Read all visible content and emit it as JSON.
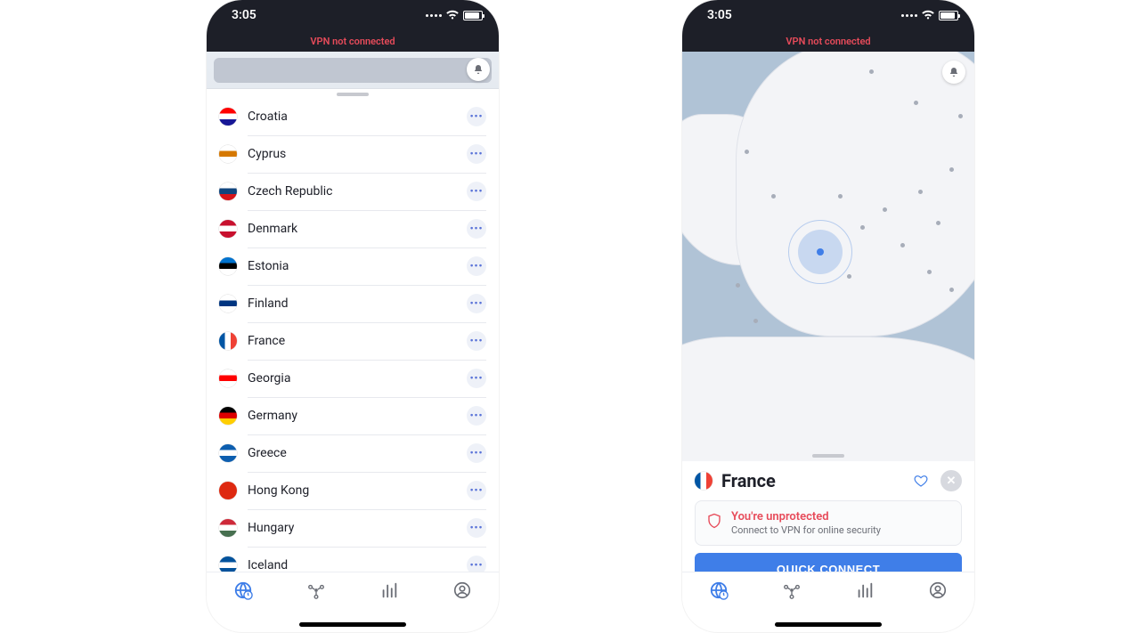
{
  "status": {
    "time": "3:05"
  },
  "banner": "VPN not connected",
  "countries": [
    {
      "name": "Croatia",
      "flag_top": "#ff0000",
      "flag_mid": "#ffffff",
      "flag_bot": "#171796"
    },
    {
      "name": "Cyprus",
      "flag_top": "#ffffff",
      "flag_mid": "#d57800",
      "flag_bot": "#ffffff"
    },
    {
      "name": "Czech Republic",
      "flag_top": "#ffffff",
      "flag_mid": "#11457e",
      "flag_bot": "#d7141a"
    },
    {
      "name": "Denmark",
      "flag_top": "#c8102e",
      "flag_mid": "#ffffff",
      "flag_bot": "#c8102e"
    },
    {
      "name": "Estonia",
      "flag_top": "#0072ce",
      "flag_mid": "#000000",
      "flag_bot": "#ffffff"
    },
    {
      "name": "Finland",
      "flag_top": "#ffffff",
      "flag_mid": "#003580",
      "flag_bot": "#ffffff"
    },
    {
      "name": "France",
      "flag_top": "#0055a4",
      "flag_mid": "#ffffff",
      "flag_bot": "#ef4135"
    },
    {
      "name": "Georgia",
      "flag_top": "#ffffff",
      "flag_mid": "#ff0000",
      "flag_bot": "#ffffff"
    },
    {
      "name": "Germany",
      "flag_top": "#000000",
      "flag_mid": "#dd0000",
      "flag_bot": "#ffce00"
    },
    {
      "name": "Greece",
      "flag_top": "#0d5eaf",
      "flag_mid": "#ffffff",
      "flag_bot": "#0d5eaf"
    },
    {
      "name": "Hong Kong",
      "flag_top": "#de2910",
      "flag_mid": "#de2910",
      "flag_bot": "#de2910"
    },
    {
      "name": "Hungary",
      "flag_top": "#ce2939",
      "flag_mid": "#ffffff",
      "flag_bot": "#477050"
    },
    {
      "name": "Iceland",
      "flag_top": "#02529c",
      "flag_mid": "#ffffff",
      "flag_bot": "#02529c"
    }
  ],
  "detail": {
    "country": "France",
    "alert_title": "You're unprotected",
    "alert_sub": "Connect to VPN for online security",
    "connect_label": "QUICK CONNECT"
  }
}
